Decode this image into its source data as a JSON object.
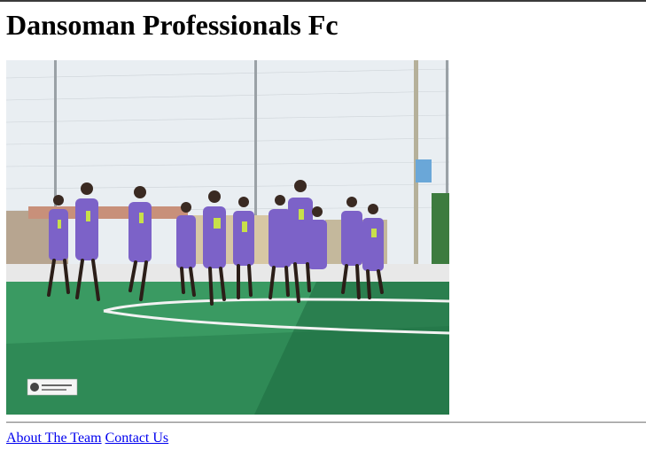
{
  "page": {
    "title": "Dansoman Professionals Fc"
  },
  "photo": {
    "description_icon": "team-photo",
    "colors": {
      "sky": "#e9eef2",
      "turf": "#2f8a56",
      "turf_dark": "#1f6e43",
      "jersey": "#7c62c8",
      "jersey_trim": "#c8e04a",
      "wall": "#e8e8e8"
    }
  },
  "nav": {
    "links": [
      {
        "label": "About The Team"
      },
      {
        "label": "Contact Us"
      }
    ]
  }
}
